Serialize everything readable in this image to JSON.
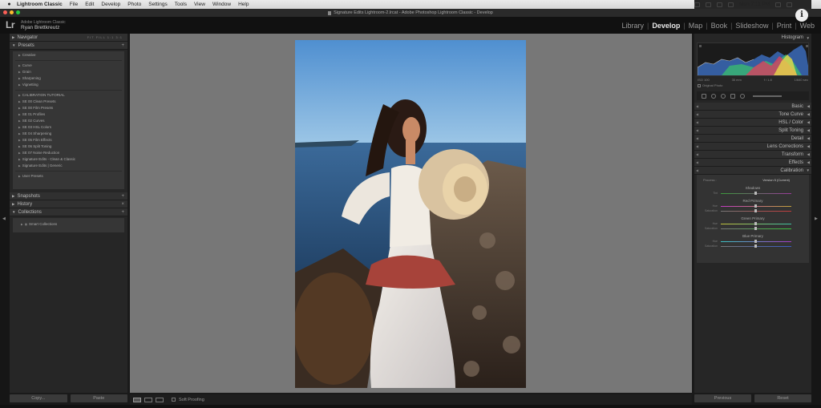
{
  "menubar": {
    "apple": "",
    "items": [
      "Lightroom Classic",
      "File",
      "Edit",
      "Develop",
      "Photo",
      "Settings",
      "Tools",
      "View",
      "Window",
      "Help"
    ],
    "clock": "Mon 7:11 PM"
  },
  "window": {
    "title": "Signature Edits Lightroom-2.lrcat - Adobe Photoshop Lightroom Classic - Develop"
  },
  "identity": {
    "logo": "Lr",
    "subtitle": "Adobe Lightroom Classic",
    "name": "Ryan Brettkreutz"
  },
  "modules": [
    "Library",
    "Develop",
    "Map",
    "Book",
    "Slideshow",
    "Print",
    "Web"
  ],
  "active_module": "Develop",
  "left_panel": {
    "navigator": "Navigator",
    "navigator_options": "FIT FILL 1:1 3:1",
    "presets": "Presets",
    "preset_groups": [
      [
        "Creative"
      ],
      [
        "Curve",
        "Grain",
        "Sharpening",
        "Vignetting"
      ],
      [
        "CALIBRATION TUTORIAL",
        "SE 00 Clean Presets",
        "SE 00 Film Presets",
        "SE 01 Profiles",
        "SE 02 Curves",
        "SE 03 HSL Colors",
        "SE 04 Sharpening",
        "SE 05 Film Effects",
        "SE 06 Split Toning",
        "SE 07 Noise Reduction",
        "Signature Edits - Clean & Classic",
        "Signature Edits | Generic"
      ],
      [
        "User Presets"
      ]
    ],
    "snapshots": "Snapshots",
    "history": "History",
    "collections": "Collections",
    "smart_collections": "Smart Collections"
  },
  "left_buttons": {
    "copy": "Copy...",
    "paste": "Paste"
  },
  "toolbar": {
    "soft_proofing": "Soft Proofing"
  },
  "right_panel": {
    "histogram": "Histogram",
    "histo_info": [
      "ISO 100",
      "35 mm",
      "f / 1.8",
      "1/640 sec"
    ],
    "original_photo": "Original Photo",
    "sections": [
      "Basic",
      "Tone Curve",
      "HSL / Color",
      "Split Toning",
      "Detail",
      "Lens Corrections",
      "Transform",
      "Effects",
      "Calibration"
    ],
    "calibration": {
      "process_label": "Process :",
      "process_value": "Version 5 (Current)",
      "shadows": "Shadows",
      "tint": "Tint",
      "red_primary": "Red Primary",
      "green_primary": "Green Primary",
      "blue_primary": "Blue Primary",
      "hue": "Hue",
      "saturation": "Saturation"
    }
  },
  "right_buttons": {
    "previous": "Previous",
    "reset": "Reset"
  },
  "colors": {
    "sky": "#5a9ad3",
    "sea": "#2a4e7a",
    "panel": "#262626",
    "center": "#777777"
  }
}
